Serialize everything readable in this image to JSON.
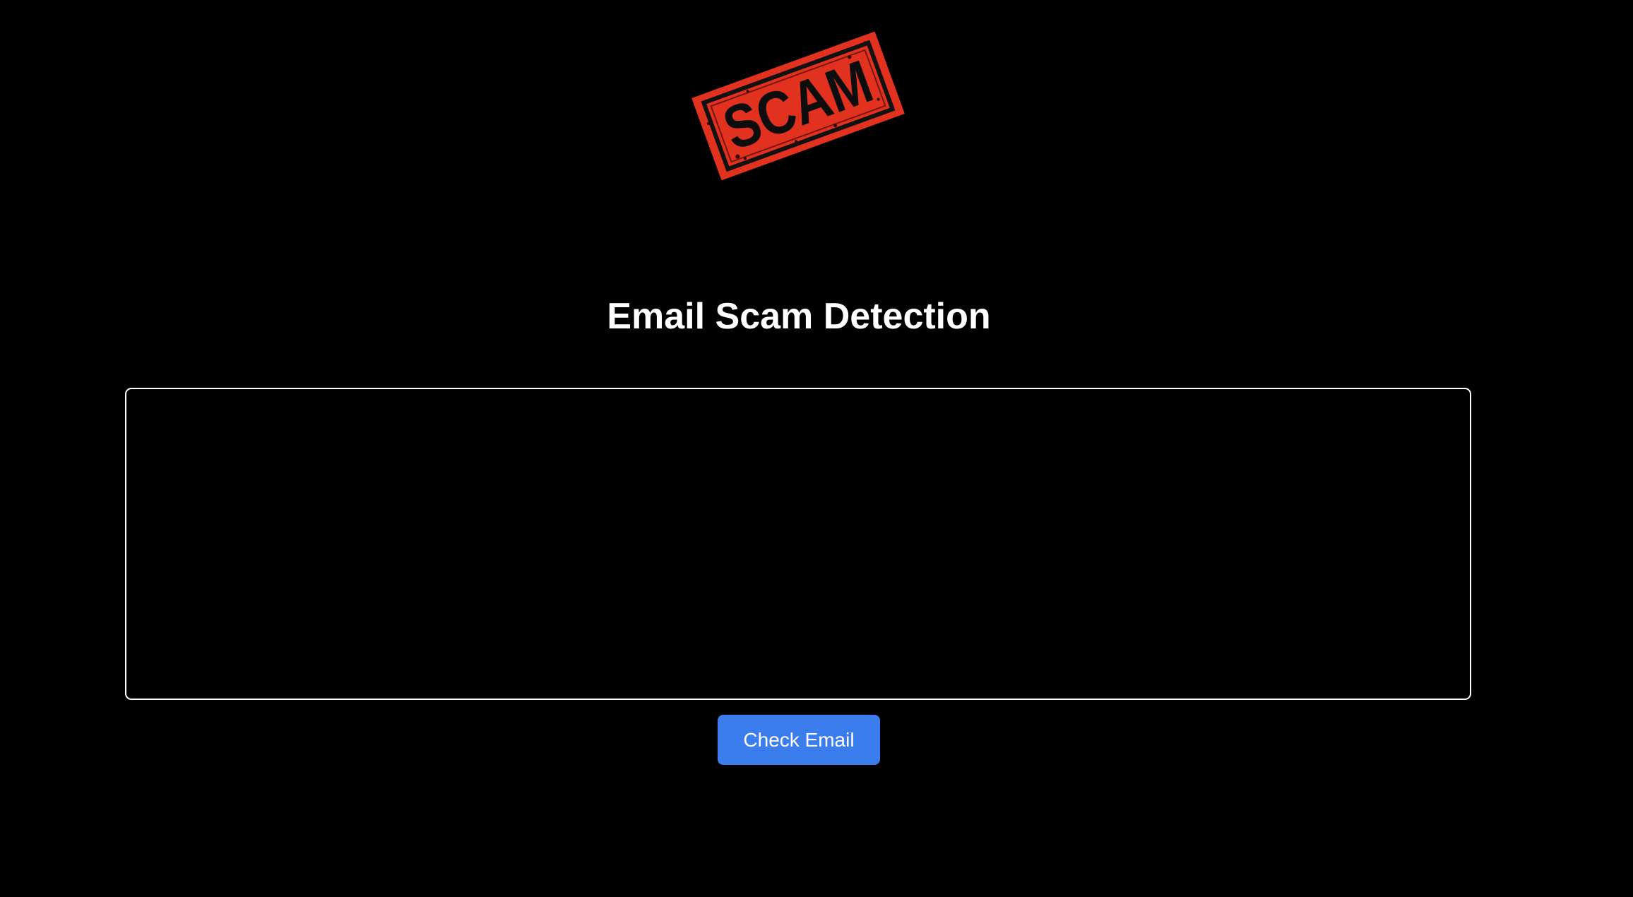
{
  "logo": {
    "stamp_text": "SCAM",
    "icon": "scam-stamp-icon",
    "color": "#e1311f"
  },
  "header": {
    "title": "Email Scam Detection"
  },
  "form": {
    "email_value": "",
    "email_placeholder": "",
    "check_button_label": "Check Email",
    "button_color": "#3b7ded"
  },
  "theme": {
    "background": "#000000",
    "text_color": "#ffffff"
  }
}
